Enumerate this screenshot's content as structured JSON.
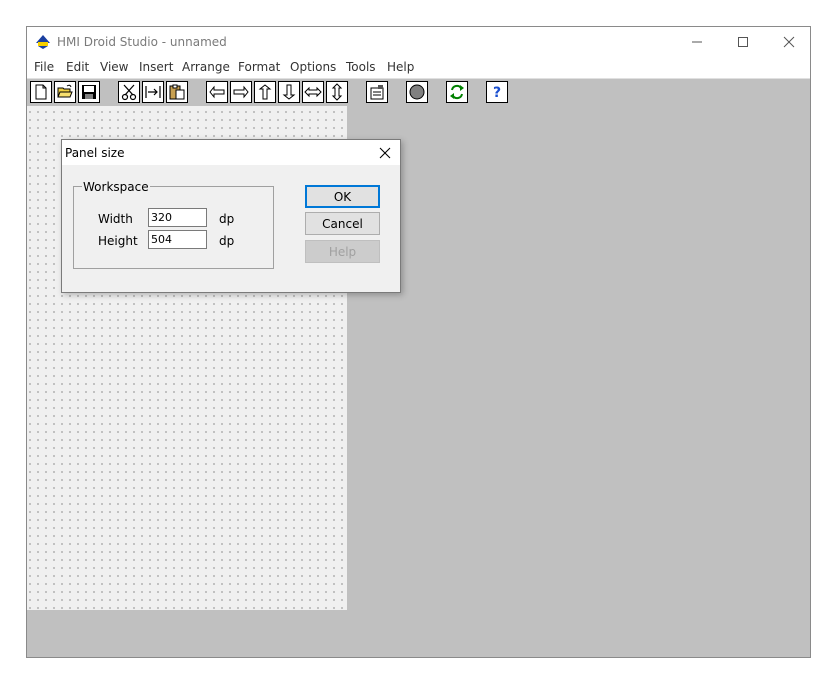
{
  "window": {
    "title": "HMI Droid Studio - unnamed",
    "controls": [
      "minimize",
      "maximize",
      "close"
    ]
  },
  "menubar": {
    "items": [
      "File",
      "Edit",
      "View",
      "Insert",
      "Arrange",
      "Format",
      "Options",
      "Tools",
      "Help"
    ]
  },
  "toolbar": {
    "buttons": [
      {
        "icon": "new-document-icon"
      },
      {
        "icon": "open-folder-icon"
      },
      {
        "icon": "save-disk-icon"
      },
      {
        "icon": "cut-scissors-icon"
      },
      {
        "icon": "copy-icon"
      },
      {
        "icon": "paste-clipboard-icon"
      },
      {
        "icon": "align-left-icon"
      },
      {
        "icon": "align-right-icon"
      },
      {
        "icon": "align-top-icon"
      },
      {
        "icon": "align-bottom-icon"
      },
      {
        "icon": "center-horizontal-icon"
      },
      {
        "icon": "center-vertical-icon"
      },
      {
        "icon": "properties-icon"
      },
      {
        "icon": "run-circle-icon"
      },
      {
        "icon": "refresh-arrows-icon"
      },
      {
        "icon": "help-question-icon"
      }
    ]
  },
  "dialog": {
    "title": "Panel size",
    "group_label": "Workspace",
    "width_label": "Width",
    "width_value": "320",
    "width_unit": "dp",
    "height_label": "Height",
    "height_value": "504",
    "height_unit": "dp",
    "ok_label": "OK",
    "cancel_label": "Cancel",
    "help_label": "Help"
  },
  "colors": {
    "toolbar_bg": "#c0c0c0",
    "workspace_bg": "#c0c0c0",
    "canvas_bg": "#f0f0f0",
    "dialog_bg": "#f0f0f0",
    "default_button_border": "#0078d7"
  }
}
